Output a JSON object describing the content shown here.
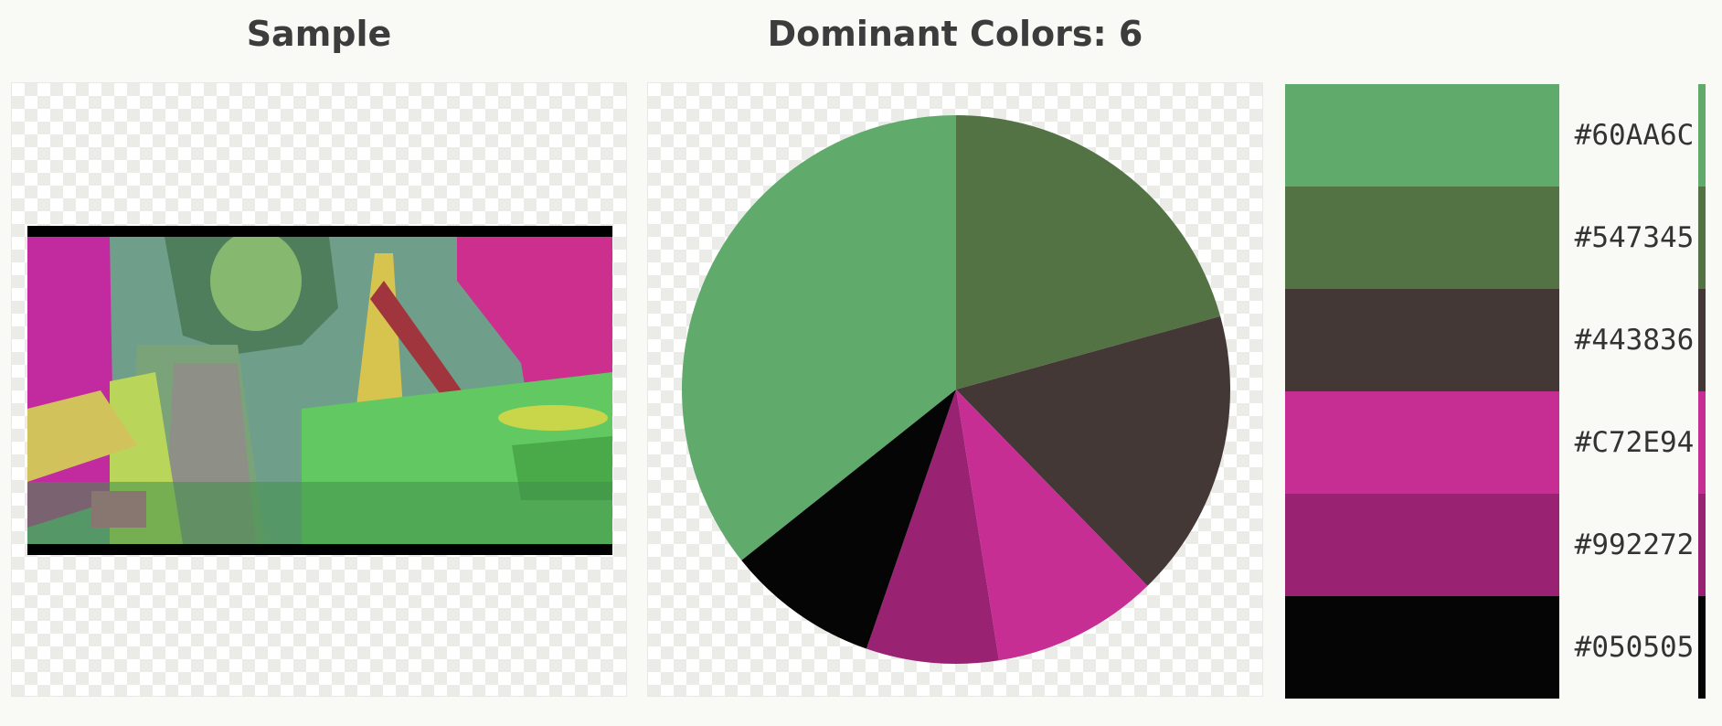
{
  "sample": {
    "title": "Sample"
  },
  "palette": {
    "title": "Dominant Colors: 6"
  },
  "chart_data": {
    "type": "pie",
    "title": "Dominant Colors: 6",
    "slices": [
      {
        "label": "#60AA6C",
        "color": "#60AA6C",
        "fraction": 0.357
      },
      {
        "label": "#547345",
        "color": "#547345",
        "fraction": 0.207
      },
      {
        "label": "#443836",
        "color": "#443836",
        "fraction": 0.17
      },
      {
        "label": "#C72E94",
        "color": "#C72E94",
        "fraction": 0.098
      },
      {
        "label": "#992272",
        "color": "#992272",
        "fraction": 0.078
      },
      {
        "label": "#050505",
        "color": "#050505",
        "fraction": 0.09
      }
    ]
  }
}
